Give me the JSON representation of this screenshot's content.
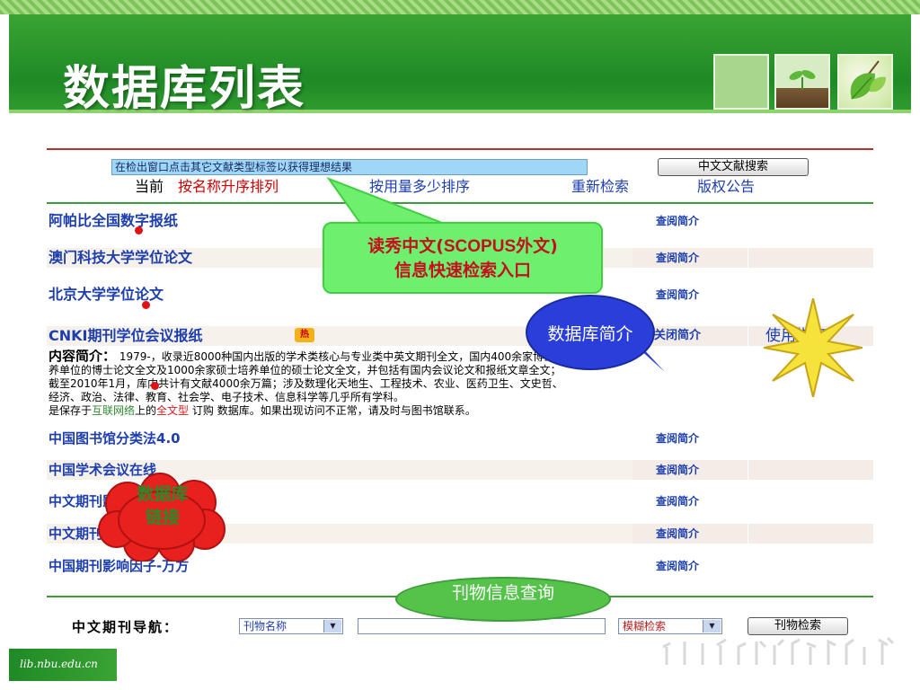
{
  "slide": {
    "title": "数据库列表",
    "footer_url": "lib.nbu.edu.cn"
  },
  "web": {
    "hint": "在检出窗口点击其它文献类型标签以获得理想结果",
    "search_button": "中文文献搜索",
    "nav": {
      "prefix": "当前",
      "selected": "按名称升序排列",
      "by_usage": "按用量多少排序",
      "research": "重新检索",
      "copyright": "版权公告"
    },
    "databases": [
      {
        "name": "阿帕比全国数字报纸",
        "action": "查阅简介"
      },
      {
        "name": "澳门科技大学学位论文",
        "action": "查阅简介"
      },
      {
        "name": "北京大学学位论文",
        "action": "查阅简介"
      },
      {
        "name": "CNKI期刊学位会议报纸",
        "action": "关闭简介",
        "guide": "使用指南",
        "hot": "热"
      },
      {
        "name": "中国图书馆分类法4.0",
        "action": "查阅简介"
      },
      {
        "name": "中国学术会议在线",
        "action": "查阅简介"
      },
      {
        "name": "中文期刊影响因子-CNKI",
        "action": "查阅简介"
      },
      {
        "name": "中文期刊影响因子-维普",
        "action": "查阅简介"
      },
      {
        "name": "中国期刊影响因子-万方",
        "action": "查阅简介"
      }
    ],
    "intro": {
      "label": "内容简介：",
      "line1": "1979-，收录近8000种国内出版的学术类核心与专业类中英文期刊全文，国内400余家博士培",
      "line2": "养单位的博士论文全文及1000余家硕士培养单位的硕士论文全文，并包括有国内会议论文和报纸文章全文；",
      "line3": "截至2010年1月，库内共计有文献4000余万篇；涉及数理化天地生、工程技术、农业、医药卫生、文史哲、",
      "line4": "经济、政治、法律、教育、社会学、电子技术、信息科学等几乎所有学科。",
      "line5_a": "是保存于",
      "line5_link": "互联网络",
      "line5_b": "上的",
      "line5_link2": "全文型",
      "line5_c": "  订购   数据库。如果出现访问不正常，请及时与图书馆联系。"
    },
    "bottom": {
      "nav_label": "中文期刊导航：",
      "field_select": "刊物名称",
      "match_select": "模糊检索",
      "search_button": "刊物检索",
      "query_value": ""
    }
  },
  "callouts": {
    "green_line1": "读秀中文(",
    "green_bold": "SCOPUS",
    "green_line1_end": "外文)",
    "green_line2": "信息快速检索入口",
    "blue": "数据库简介",
    "cloud_line1": "数据库",
    "cloud_line2": "链接",
    "bottom_bubble": "刊物信息查询"
  },
  "colors": {
    "title_band": "#2f9b2e",
    "link_blue": "#1d3fae",
    "selected_red": "#cc0000",
    "green_callout": "#6ef06e",
    "blue_callout": "#2a3fd9",
    "cloud_red": "#e8201e"
  }
}
